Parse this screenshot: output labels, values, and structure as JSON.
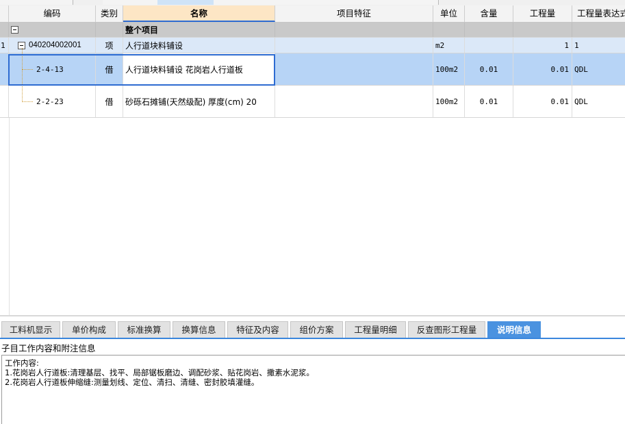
{
  "top_tabs": [
    "",
    "",
    "",
    "",
    "",
    "",
    "",
    ""
  ],
  "grid": {
    "columns": {
      "code": "编码",
      "category": "类别",
      "name": "名称",
      "feature": "项目特征",
      "unit": "单位",
      "content": "含量",
      "quantity": "工程量",
      "expression": "工程量表达式"
    },
    "rows": [
      {
        "rownum": "",
        "code": "",
        "category": "",
        "name": "整个项目",
        "feature": "",
        "unit": "",
        "content": "",
        "quantity": "",
        "expression": ""
      },
      {
        "rownum": "1",
        "code": "040204002001",
        "category": "项",
        "name": "人行道块料铺设",
        "feature": "",
        "unit": "m2",
        "content": "",
        "quantity": "1",
        "expression": "1"
      },
      {
        "rownum": "",
        "code": "2-4-13",
        "category": "借",
        "name": "人行道块料铺设 花岗岩人行道板",
        "feature": "",
        "unit": "100m2",
        "content": "0.01",
        "quantity": "0.01",
        "expression": "QDL"
      },
      {
        "rownum": "",
        "code": "2-2-23",
        "category": "借",
        "name": "砂砾石摊铺(天然级配) 厚度(cm) 20",
        "feature": "",
        "unit": "100m2",
        "content": "0.01",
        "quantity": "0.01",
        "expression": "QDL"
      }
    ]
  },
  "bottom_tabs": [
    "工料机显示",
    "单价构成",
    "标准换算",
    "换算信息",
    "特征及内容",
    "组价方案",
    "工程量明细",
    "反查图形工程量",
    "说明信息"
  ],
  "active_bottom_tab": "说明信息",
  "panel": {
    "title": "子目工作内容和附注信息",
    "lines": [
      "工作内容:",
      "1.花岗岩人行道板:清理基层、找平、局部锯板磨边、调配砂浆、贴花岗岩、撒素水泥浆。",
      "2.花岗岩人行道板伸缩缝:测量划线、定位、清扫、清缝、密封胶填灌缝。"
    ]
  },
  "colors": {
    "accent": "#2d6bd1",
    "active_tab": "#4a92e0",
    "name_header": "#fde6c5",
    "selected_row": "#b7d4f6"
  }
}
